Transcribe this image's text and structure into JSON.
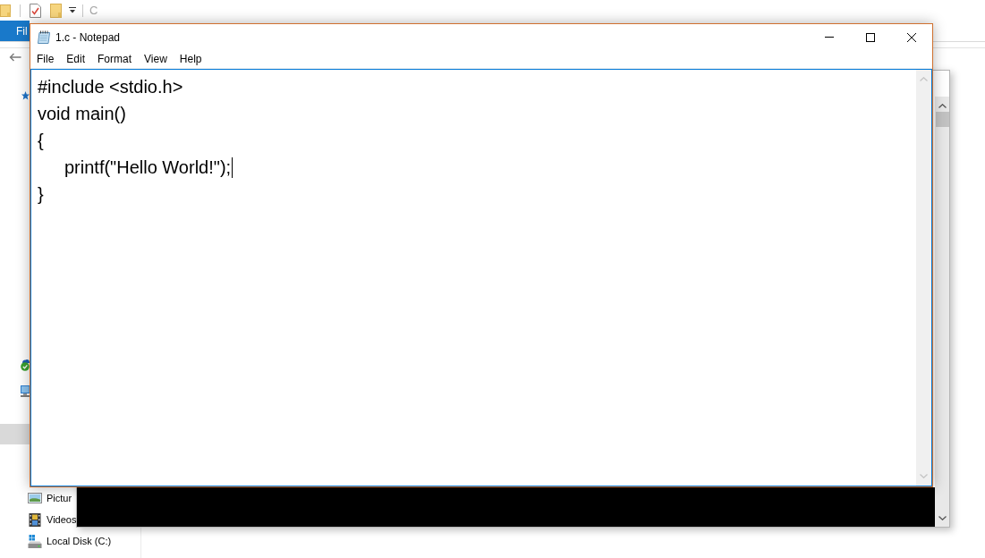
{
  "explorer": {
    "title": "C",
    "file_tab": "Fil",
    "nav_items": [
      {
        "kind": "pictures",
        "label": "Pictur"
      },
      {
        "kind": "videos",
        "label": "Videos"
      },
      {
        "kind": "drive",
        "label": "Local Disk (C:)"
      }
    ]
  },
  "notepad": {
    "title": "1.c - Notepad",
    "menu": [
      "File",
      "Edit",
      "Format",
      "View",
      "Help"
    ],
    "lines": [
      {
        "text": "#include <stdio.h>",
        "caret": false
      },
      {
        "text": "void main()",
        "caret": false
      },
      {
        "text": "{",
        "caret": false
      },
      {
        "text": "\tprintf(\"Hello World!\");",
        "caret": true
      },
      {
        "text": "}",
        "caret": false
      }
    ]
  }
}
